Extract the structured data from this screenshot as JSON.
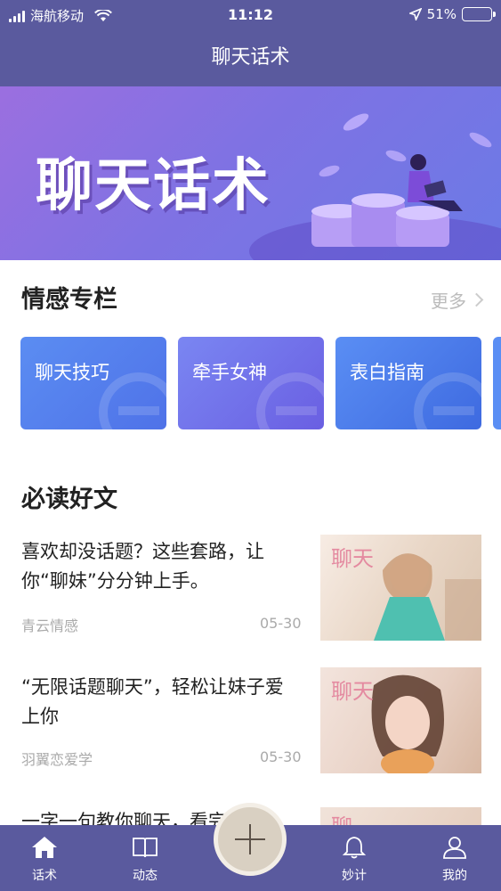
{
  "status_bar": {
    "carrier": "海航移动",
    "time": "11:12",
    "battery": "51%",
    "battery_level": 0.51
  },
  "nav": {
    "title": "聊天话术"
  },
  "banner": {
    "title": "聊天话术"
  },
  "emotion_section": {
    "title": "情感专栏",
    "more": "更多",
    "cards": [
      {
        "label": "聊天技巧",
        "color_from": "#5b8df2",
        "color_to": "#4f72e8"
      },
      {
        "label": "牵手女神",
        "color_from": "#7a86f2",
        "color_to": "#6a5fe2"
      },
      {
        "label": "表白指南",
        "color_from": "#5a8ef4",
        "color_to": "#3e6ae0"
      }
    ]
  },
  "articles_section": {
    "title": "必读好文",
    "items": [
      {
        "title": "喜欢却没话题？这些套路，让你“聊妹”分分钟上手。",
        "source": "青云情感",
        "date": "05-30",
        "thumb_text": "聊天"
      },
      {
        "title": "“无限话题聊天”，轻松让妹子爱上你",
        "source": "羽翼恋爱学",
        "date": "05-30",
        "thumb_text": "聊天"
      },
      {
        "title": "一字一句教你聊天，看完一",
        "source": "",
        "date": "",
        "thumb_text": "聊"
      }
    ]
  },
  "tabbar": {
    "tabs": [
      {
        "label": "话术",
        "icon": "home-icon"
      },
      {
        "label": "动态",
        "icon": "book-icon"
      },
      {
        "label": "妙计",
        "icon": "bell-icon"
      },
      {
        "label": "我的",
        "icon": "user-icon"
      }
    ],
    "center_icon": "plus-icon"
  }
}
